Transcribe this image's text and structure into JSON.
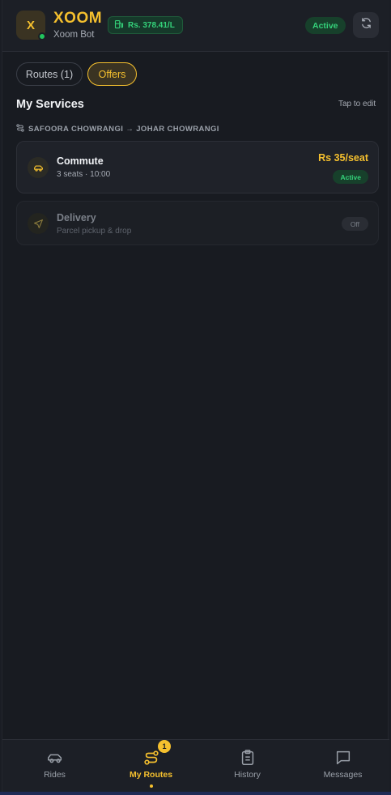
{
  "header": {
    "logo_letter": "X",
    "brand": "XOOM",
    "subtitle": "Xoom Bot",
    "fuel_price": "Rs. 378.41/L",
    "status": "Active"
  },
  "tabs": [
    {
      "label": "Routes (1)"
    },
    {
      "label": "Offers",
      "selected": true
    }
  ],
  "services": {
    "title": "My Services",
    "edit_hint": "Tap to edit",
    "route": "SAFOORA CHOWRANGI → JOHAR CHOWRANGI",
    "items": [
      {
        "name": "Commute",
        "detail": "3 seats · 10:00",
        "price": "Rs 35/seat",
        "status": "Active",
        "icon": "car-icon"
      },
      {
        "name": "Delivery",
        "detail": "Parcel pickup & drop",
        "status": "Off",
        "icon": "send-icon"
      }
    ]
  },
  "nav": {
    "items": [
      {
        "label": "Rides",
        "icon": "car-icon"
      },
      {
        "label": "My Routes",
        "icon": "route-icon",
        "badge": "1",
        "active": true
      },
      {
        "label": "History",
        "icon": "clipboard-icon"
      },
      {
        "label": "Messages",
        "icon": "chat-icon"
      }
    ]
  },
  "colors": {
    "accent": "#f5c02e",
    "success": "#34d27a",
    "background": "#181b21"
  }
}
